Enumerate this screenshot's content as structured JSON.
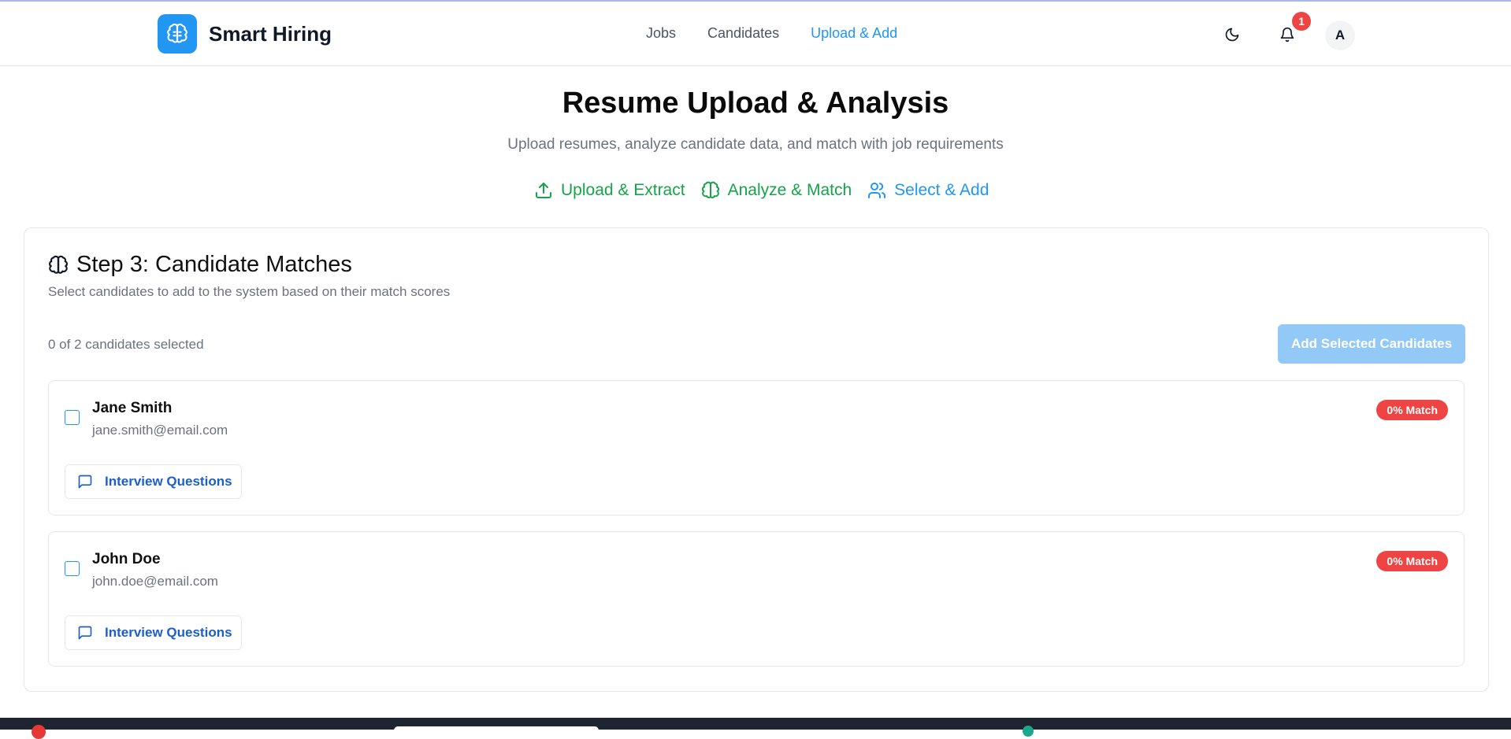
{
  "header": {
    "brand": "Smart Hiring",
    "nav": [
      {
        "label": "Jobs",
        "active": false
      },
      {
        "label": "Candidates",
        "active": false
      },
      {
        "label": "Upload & Add",
        "active": true
      }
    ],
    "notification_count": "1",
    "avatar_initial": "A",
    "icons": [
      "brain-icon",
      "moon-icon",
      "bell-icon"
    ]
  },
  "page": {
    "title": "Resume Upload & Analysis",
    "subtitle": "Upload resumes, analyze candidate data, and match with job requirements"
  },
  "steps": [
    {
      "label": "Upload & Extract",
      "icon": "upload-icon",
      "status": "done"
    },
    {
      "label": "Analyze & Match",
      "icon": "brain-icon",
      "status": "done"
    },
    {
      "label": "Select & Add",
      "icon": "users-icon",
      "status": "current"
    }
  ],
  "card": {
    "title": "Step 3: Candidate Matches",
    "description": "Select candidates to add to the system based on their match scores",
    "selected_count_text": "0 of 2 candidates selected",
    "add_button_label": "Add Selected Candidates"
  },
  "candidates": [
    {
      "name": "Jane Smith",
      "email": "jane.smith@email.com",
      "match": "0% Match",
      "action_label": "Interview Questions",
      "checked": false
    },
    {
      "name": "John Doe",
      "email": "john.doe@email.com",
      "match": "0% Match",
      "action_label": "Interview Questions",
      "checked": false
    }
  ],
  "colors": {
    "primary": "#2196f3",
    "success": "#16a34a",
    "danger": "#ef4444",
    "link": "#1d5ecf",
    "muted_text": "#6b7280"
  }
}
